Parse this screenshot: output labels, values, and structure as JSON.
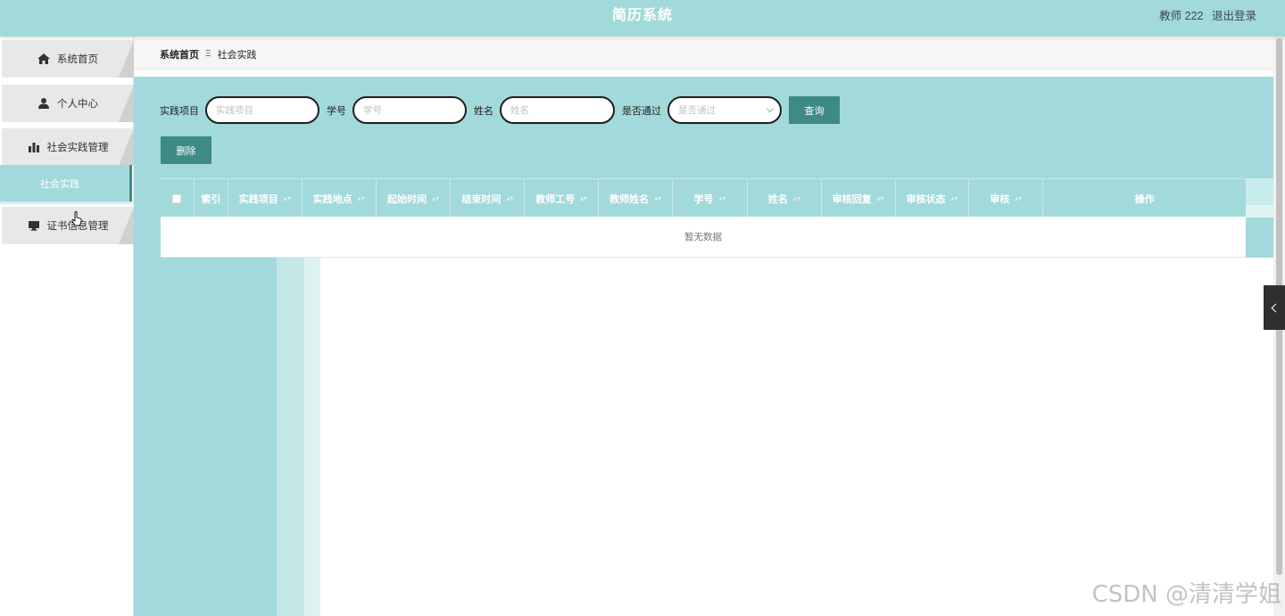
{
  "header": {
    "title": "简历系统",
    "user": "教师 222",
    "logout": "退出登录"
  },
  "sidebar": {
    "items": [
      {
        "label": "系统首页",
        "icon": "home-icon"
      },
      {
        "label": "个人中心",
        "icon": "user-icon"
      },
      {
        "label": "社会实践管理",
        "icon": "bar-chart-icon"
      },
      {
        "label": "证书信息管理",
        "icon": "monitor-icon"
      }
    ],
    "sub_item": "社会实践"
  },
  "breadcrumb": {
    "home": "系统首页",
    "separator": "Ξ",
    "current": "社会实践"
  },
  "search": {
    "project_label": "实践项目",
    "project_placeholder": "实践项目",
    "student_no_label": "学号",
    "student_no_placeholder": "学号",
    "name_label": "姓名",
    "name_placeholder": "姓名",
    "passed_label": "是否通过",
    "passed_placeholder": "是否通过",
    "search_button": "查询"
  },
  "actions": {
    "delete_button": "删除"
  },
  "table": {
    "columns": [
      "索引",
      "实践项目",
      "实践地点",
      "起始时间",
      "结束时间",
      "教师工号",
      "教师姓名",
      "学号",
      "姓名",
      "审核回复",
      "审核状态",
      "审核",
      "操作"
    ],
    "empty_text": "暂无数据"
  },
  "watermark": "CSDN @清清学姐",
  "colors": {
    "header_bg": "#a2d9db",
    "button_bg": "#3d8a87",
    "sidebar_tab": "#e8e8e8"
  }
}
